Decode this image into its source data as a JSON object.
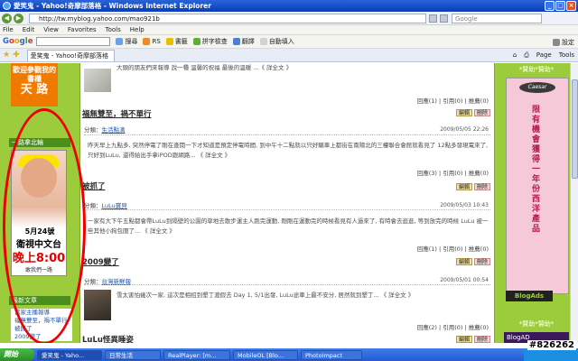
{
  "window": {
    "title": "愛笑鬼 - Yahoo!奇摩部落格 - Windows Internet Explorer",
    "min": "_",
    "max": "□",
    "close": "×"
  },
  "address": {
    "url": "http://tw.myblog.yahoo.com/mao921b",
    "live_search_placeholder": "Google"
  },
  "menu": [
    "File",
    "Edit",
    "View",
    "Favorites",
    "Tools",
    "Help"
  ],
  "google_toolbar": {
    "logo": [
      "G",
      "o",
      "o",
      "g",
      "l",
      "e"
    ],
    "search_label": "搜尋",
    "buttons": [
      "RS",
      "書籤",
      "拼字檢查",
      "翻譯",
      "自動填入"
    ],
    "settings_label": "設定"
  },
  "tabs": {
    "active": "愛笑鬼 - Yahoo!奇摩部落格",
    "page_label": "Page",
    "tools_label": "Tools"
  },
  "sidebar_left": {
    "promo_text": "歡迎參觀我的書櫃",
    "promo_big": "天 路",
    "box_title": "一路拿北輪",
    "ad_date": "5月24號",
    "ad_channel": "衛視中文台",
    "ad_time": "晚上8:00",
    "ad_tag": "敢我們一路",
    "articles_header": "最新文章",
    "article_links": [
      "當家主播報導",
      "福無雙至，禍不單行",
      "被抓了",
      "2009變了"
    ]
  },
  "posts": [
    {
      "title": "",
      "body": "大頭的朋友們來報導 說一種 溫馨的祝福 最後的溫暖 ...《 詳全文 》",
      "stats": "回應(1) | 引用(0) | 推薦(0)"
    },
    {
      "title": "福無雙至，禍不單行",
      "category_label": "分類：",
      "category": "生活點滴",
      "date": "2009/05/05 22:26",
      "body": "昨天早上九點多, 突然停電了剛在查閱一下才知道是預定停電時間, 到中午十二點就以只好驅車上都街在南陽北的三樓聯合會館就看見了 12點多發現電來了, 只好到LuLu, 還得給出手拿iPOD跟網路... 《 詳全文 》",
      "stats": "回應(3) | 引用(0) | 推薦(0)"
    },
    {
      "title": "被抓了",
      "category_label": "分類：",
      "category": "LuLu寶貝",
      "date": "2009/05/03 10:43",
      "body": "一家有大下午五點都會帶LuLu到隔壁的公園的草地去散步運主人跑完運動, 剛剛在運動完的時候看見有人過來了, 有時會去逛逛, 等到放完的時候 LuLu 被一些其他小狗包圍了... 《 詳全文 》",
      "stats": "回應(1) | 引用(0) | 推薦(0)"
    },
    {
      "title": "2009變了",
      "category_label": "分類：",
      "category": "台灣新鮮報",
      "date": "2009/05/01 00:54",
      "body": "雪太害怕幾次一家, 這次是相招到墾丁渡假去 Day 1, 5/1出發, LuLu途車上最不安分, 居然就到墾丁... 《 詳全文 》",
      "stats": "回應(2) | 引用(0) | 推薦(0)"
    },
    {
      "title": "LuLu怪異睡姿"
    }
  ],
  "post_actions": {
    "edit": "編輯",
    "delete": "刪除"
  },
  "sidebar_right": {
    "header_top": "*贊助*贊助*",
    "ad_logo": "Caesar",
    "ad_text": "限有機會獲得一年份西洋產品",
    "blogads_label": "BlogAds",
    "header_bottom": "*贊助*贊助*",
    "blogad_label": "BlogAD"
  },
  "taskbar": {
    "start": "開始",
    "tasks": [
      "愛笑鬼 - Yaho...",
      "日常生活",
      "RealPlayer: [m...",
      "MobileOL [Blo...",
      "PhotoImpact"
    ]
  },
  "watermark": "#826262",
  "colors": {
    "page_bg": "#9ccc3c",
    "title_blue": "#0a3cb8",
    "red_annotation": "#e00000"
  }
}
